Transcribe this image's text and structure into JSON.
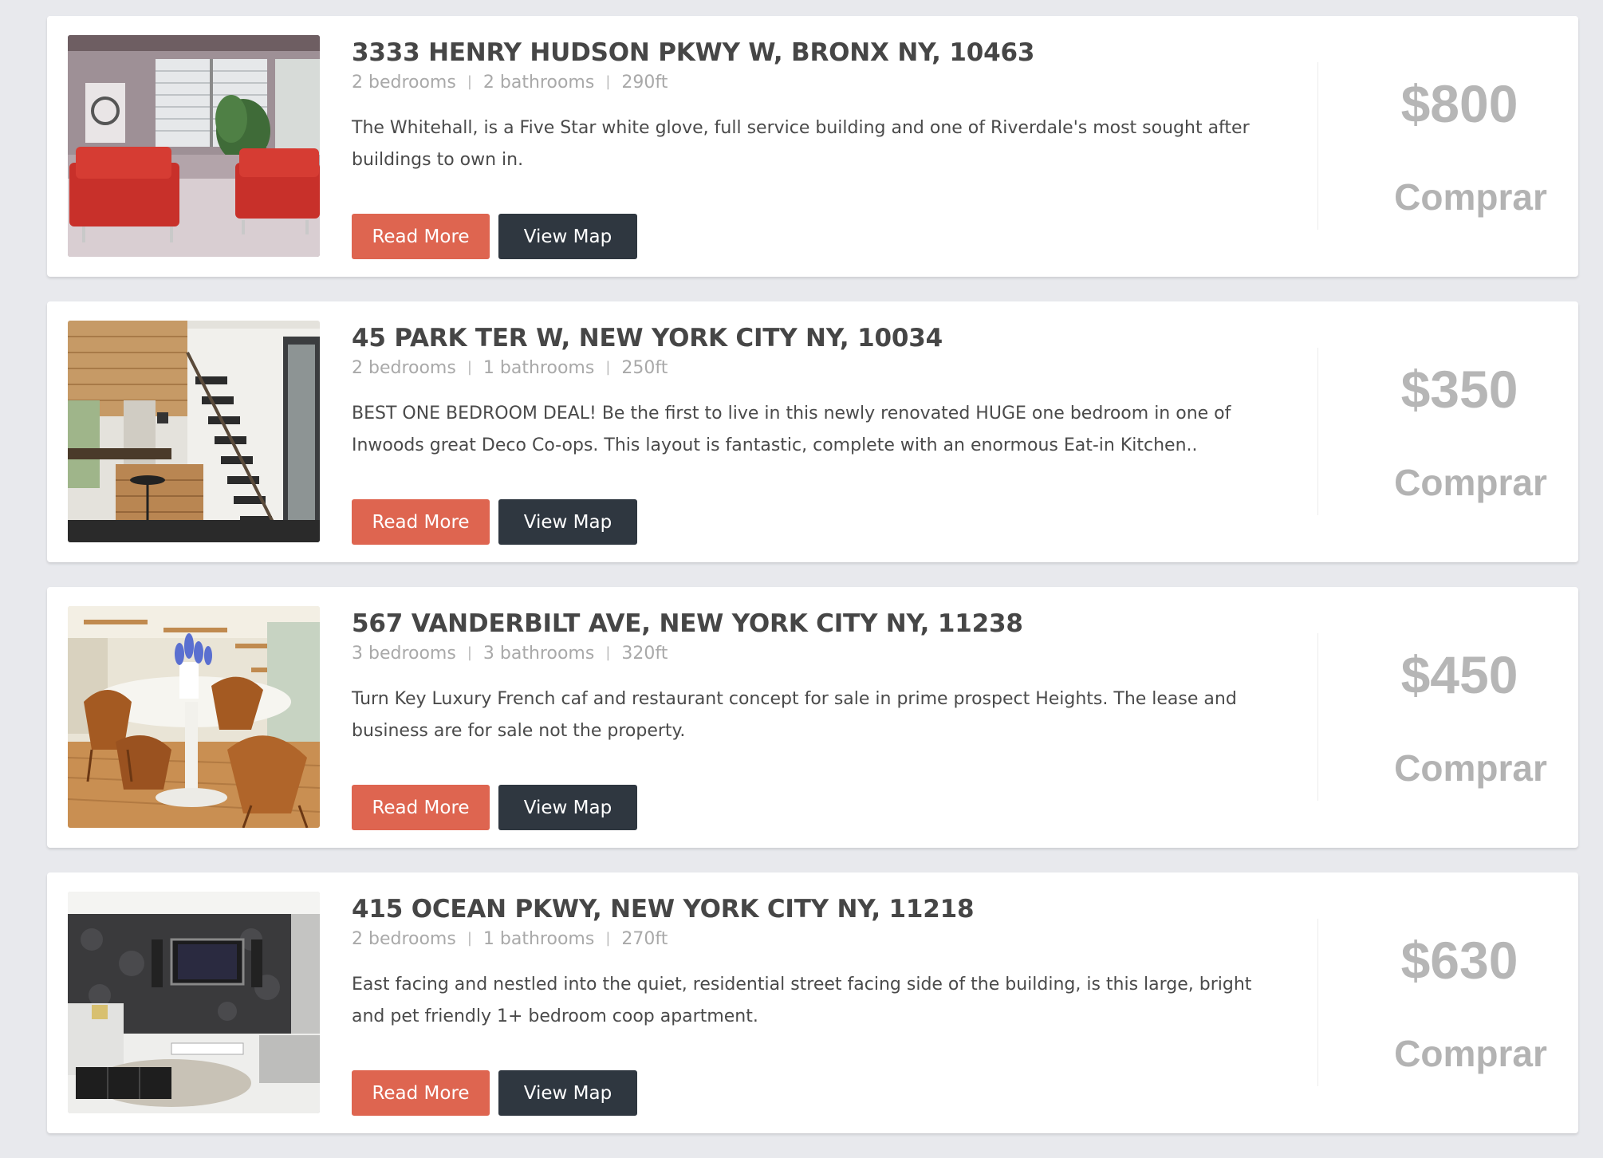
{
  "listings": [
    {
      "address": "3333 HENRY HUDSON PKWY W, BRONX NY, 10463",
      "bedrooms": "2 bedrooms",
      "bathrooms": "2 bathrooms",
      "area": "290ft",
      "description": "The Whitehall, is a Five Star white glove, full service building and one of Riverdale's most sought after buildings to own in.",
      "read_more": "Read More",
      "view_map": "View Map",
      "price": "$800",
      "action": "Comprar",
      "image": "living-room-red-armchairs-photo"
    },
    {
      "address": "45 PARK TER W, NEW YORK CITY NY, 10034",
      "bedrooms": "2 bedrooms",
      "bathrooms": "1 bathrooms",
      "area": "250ft",
      "description": "BEST ONE BEDROOM DEAL! Be the first to live in this newly renovated HUGE one bedroom in one of Inwoods great Deco Co-ops. This layout is fantastic, complete with an enormous Eat-in Kitchen..",
      "read_more": "Read More",
      "view_map": "View Map",
      "price": "$350",
      "action": "Comprar",
      "image": "kitchen-staircase-photo"
    },
    {
      "address": "567 VANDERBILT AVE, NEW YORK CITY NY, 11238",
      "bedrooms": "3 bedrooms",
      "bathrooms": "3 bathrooms",
      "area": "320ft",
      "description": "Turn Key Luxury French caf and restaurant concept for sale in prime prospect Heights. The lease and business are for sale not the property.",
      "read_more": "Read More",
      "view_map": "View Map",
      "price": "$450",
      "action": "Comprar",
      "image": "dining-table-chairs-photo"
    },
    {
      "address": "415 OCEAN PKWY, NEW YORK CITY NY, 11218",
      "bedrooms": "2 bedrooms",
      "bathrooms": "1 bathrooms",
      "area": "270ft",
      "description": "East facing and nestled into the quiet, residential street facing side of the building, is this large, bright and pet friendly 1+ bedroom coop apartment.",
      "read_more": "Read More",
      "view_map": "View Map",
      "price": "$630",
      "action": "Comprar",
      "image": "tv-living-room-photo"
    }
  ],
  "colors": {
    "page_background": "#e8e9ed",
    "read_more_button": "#de6550",
    "view_map_button": "#2f3740",
    "title_text": "#464646",
    "price_text": "#b6b6b6"
  }
}
